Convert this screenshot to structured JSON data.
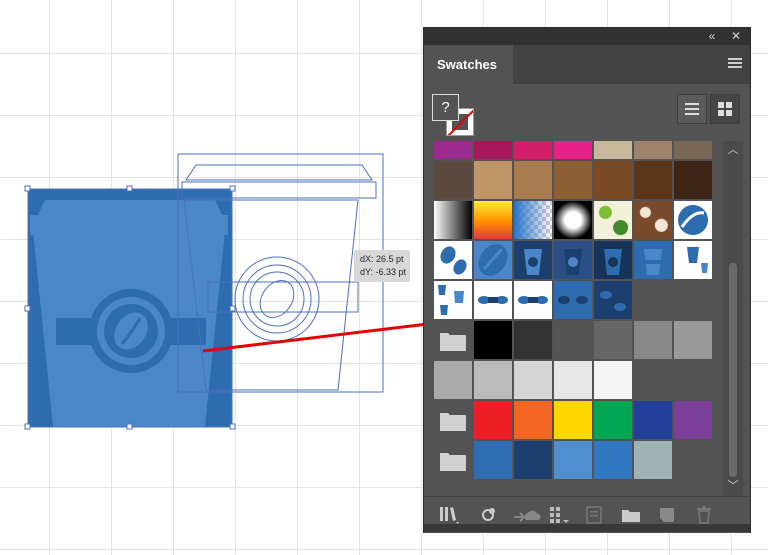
{
  "panel": {
    "title": "Swatches",
    "collapse_label": "«",
    "close_label": "✕"
  },
  "fill_stroke": {
    "fill_label": "?"
  },
  "drag_tooltip": {
    "dx": "dX: 26.5 pt",
    "dy": "dY: -6.33 pt"
  },
  "colors": {
    "accent_blue": "#4a6fbf",
    "arrow_red": "#e60000",
    "panel_bg": "#535353"
  },
  "swatch_rows": [
    [
      "#9b2b8e",
      "#a5185c",
      "#d31d6a",
      "#e8208a",
      "#c9b99b",
      "#a0826d",
      "#7a6655"
    ],
    [
      "#5c4a3f",
      "#c09669",
      "#a87c50",
      "#8d5f35",
      "#7a4b24",
      "#5a3518",
      "#3e2515"
    ],
    [
      "gradient-gray",
      "gradient-orange",
      "gradient-blue-check",
      "gradient-radial",
      "pattern-leaves",
      "pattern-swirl",
      "logo-bean"
    ],
    [
      "cup-bean",
      "bean-big",
      "cup-blue",
      "cup-bean-dark",
      "cup-dark",
      "cup-bean-light",
      "cup-small-white"
    ],
    [
      "cups-row",
      "pattern-bean-blue",
      "pattern-bean-blue",
      "pattern-bean-dark",
      "pattern-bean-navy"
    ]
  ],
  "gray_group": [
    "#000000",
    "#333333",
    "#555555",
    "#666666",
    "#888888",
    "#999999"
  ],
  "gray_group_row2": [
    "#aaaaaa",
    "#bbbbbb",
    "#d5d5d5",
    "#e7e7e7",
    "#f5f5f5"
  ],
  "bright_group": [
    "#ee1c25",
    "#f26522",
    "#ffd700",
    "#00a651",
    "#21409a",
    "#7c3f98"
  ],
  "blue_group": [
    "#2e6db2",
    "#1c3f6e",
    "#4f8fd0",
    "#3077c0",
    "#9fb3b4"
  ],
  "bottom_icons": [
    "library-icon",
    "place-swatch-icon",
    "cloud-sync-icon",
    "swatch-kind-icon",
    "swatch-options-icon",
    "new-group-icon",
    "new-swatch-icon",
    "delete-icon"
  ]
}
